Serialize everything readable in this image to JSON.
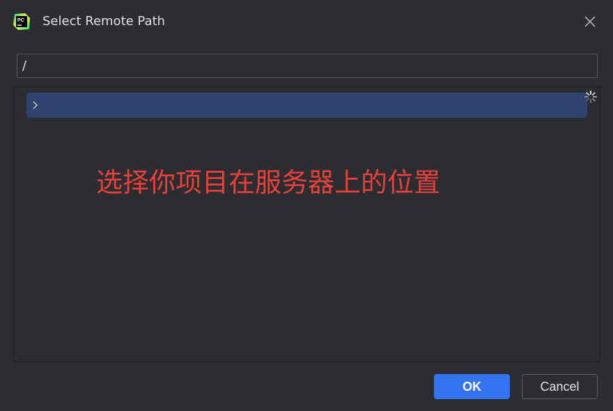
{
  "window": {
    "title": "Select Remote Path",
    "app_icon_text": "PC",
    "close_icon": "close-icon"
  },
  "path_field": {
    "value": "/"
  },
  "tree": {
    "root_row": {
      "expand_icon": "chevron-right-icon",
      "selected": true
    },
    "loading_icon": "spinner-icon"
  },
  "annotation": {
    "text": "选择你项目在服务器上的位置",
    "color": "#e8403a"
  },
  "buttons": {
    "ok_label": "OK",
    "cancel_label": "Cancel"
  },
  "colors": {
    "background": "#2b2d30",
    "selection": "#2e436e",
    "primary_button": "#3574f0"
  }
}
